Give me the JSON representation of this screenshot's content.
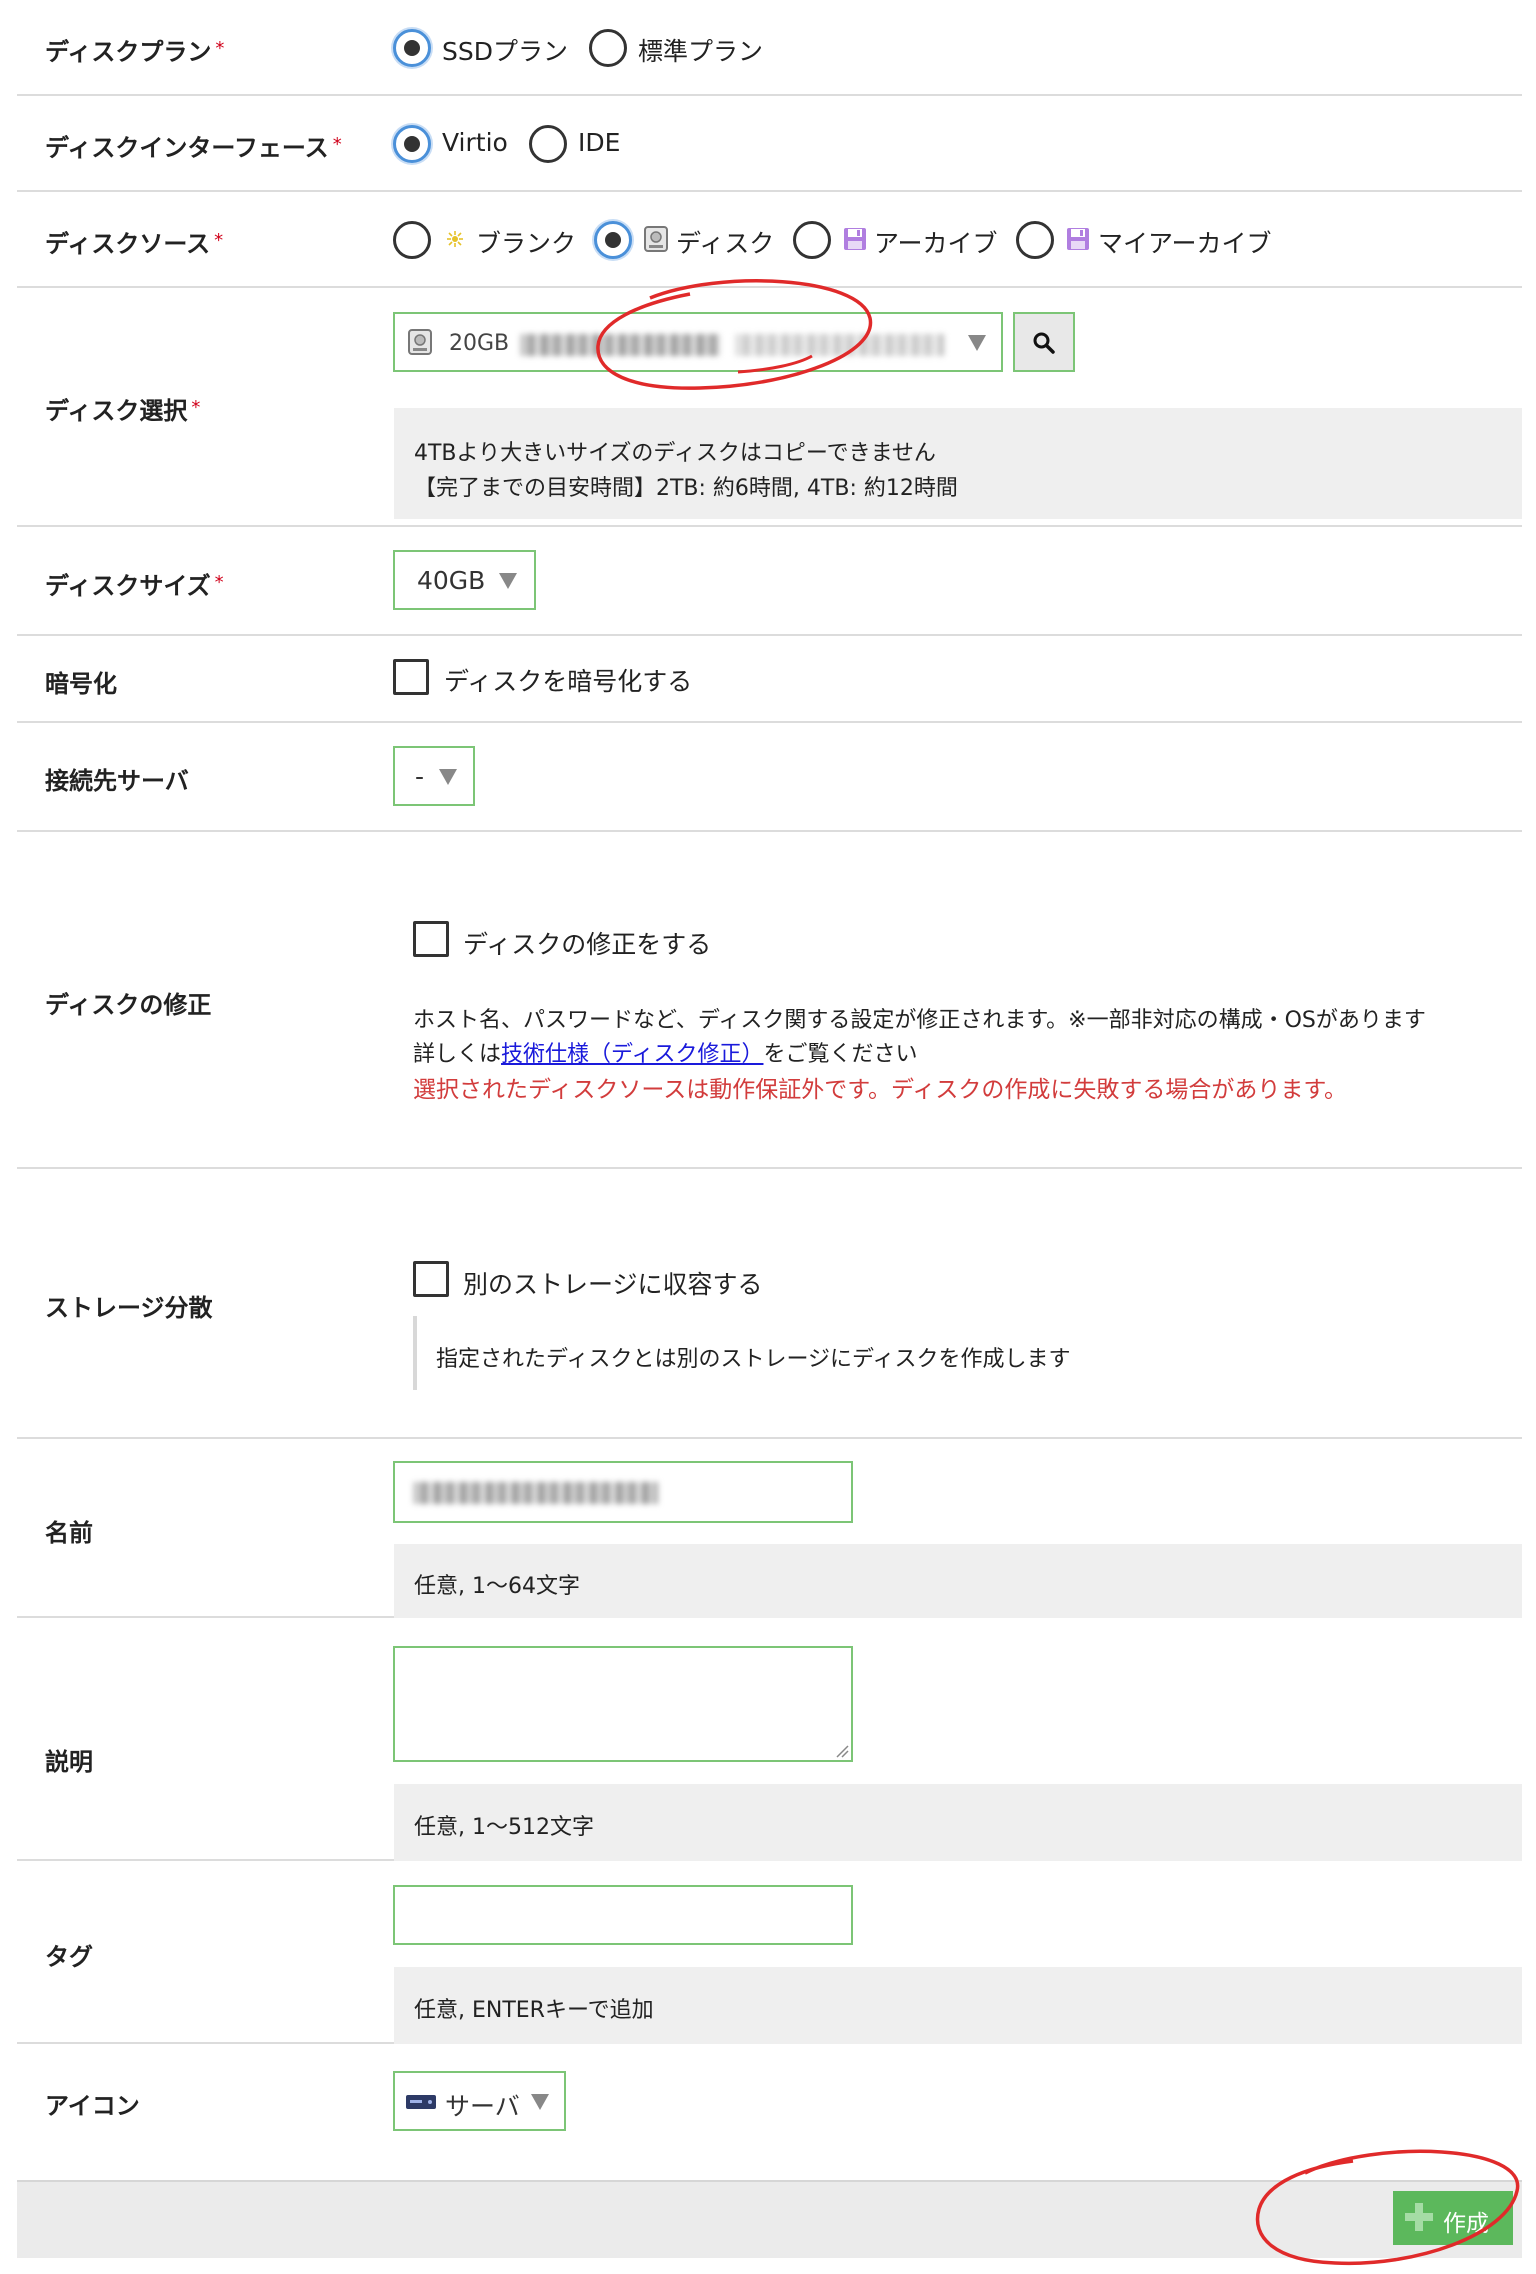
{
  "required_mark": "*",
  "disk_plan": {
    "label": "ディスクプラン",
    "options": [
      "SSDプラン",
      "標準プラン"
    ],
    "selected": 0
  },
  "disk_interface": {
    "label": "ディスクインターフェース",
    "options": [
      "Virtio",
      "IDE"
    ],
    "selected": 0
  },
  "disk_source": {
    "label": "ディスクソース",
    "options": [
      "ブランク",
      "ディスク",
      "アーカイブ",
      "マイアーカイブ"
    ],
    "selected": 1
  },
  "disk_select": {
    "label": "ディスク選択",
    "value_prefix": "20GB",
    "note_line1": "4TBより大きいサイズのディスクはコピーできません",
    "note_line2": "【完了までの目安時間】2TB: 約6時間, 4TB: 約12時間"
  },
  "disk_size": {
    "label": "ディスクサイズ",
    "value": "40GB"
  },
  "encryption": {
    "label": "暗号化",
    "checkbox_label": "ディスクを暗号化する",
    "checked": false
  },
  "server": {
    "label": "接続先サーバ",
    "value": "-"
  },
  "disk_modify": {
    "label": "ディスクの修正",
    "checkbox_label": "ディスクの修正をする",
    "checked": false,
    "line1": "ホスト名、パスワードなど、ディスク関する設定が修正されます。※一部非対応の構成・OSがあります",
    "line2_prefix": "詳しくは",
    "line2_link": "技術仕様（ディスク修正）",
    "line2_suffix": "をご覧ください",
    "warning": "選択されたディスクソースは動作保証外です。ディスクの作成に失敗する場合があります。"
  },
  "storage": {
    "label": "ストレージ分散",
    "checkbox_label": "別のストレージに収容する",
    "checked": false,
    "note": "指定されたディスクとは別のストレージにディスクを作成します"
  },
  "name": {
    "label": "名前",
    "note": "任意, 1〜64文字"
  },
  "description": {
    "label": "説明",
    "note": "任意, 1〜512文字"
  },
  "tags": {
    "label": "タグ",
    "note": "任意, ENTERキーで追加"
  },
  "icon": {
    "label": "アイコン",
    "value": "サーバ"
  },
  "create_button": {
    "label": "作成"
  },
  "colors": {
    "accent_green": "#5cb85c",
    "border_green": "#7cc576",
    "required_red": "#d0021b",
    "warning_red": "#d23c3c",
    "link_blue": "#1a1adb",
    "annotation_red": "#e02a2a"
  }
}
